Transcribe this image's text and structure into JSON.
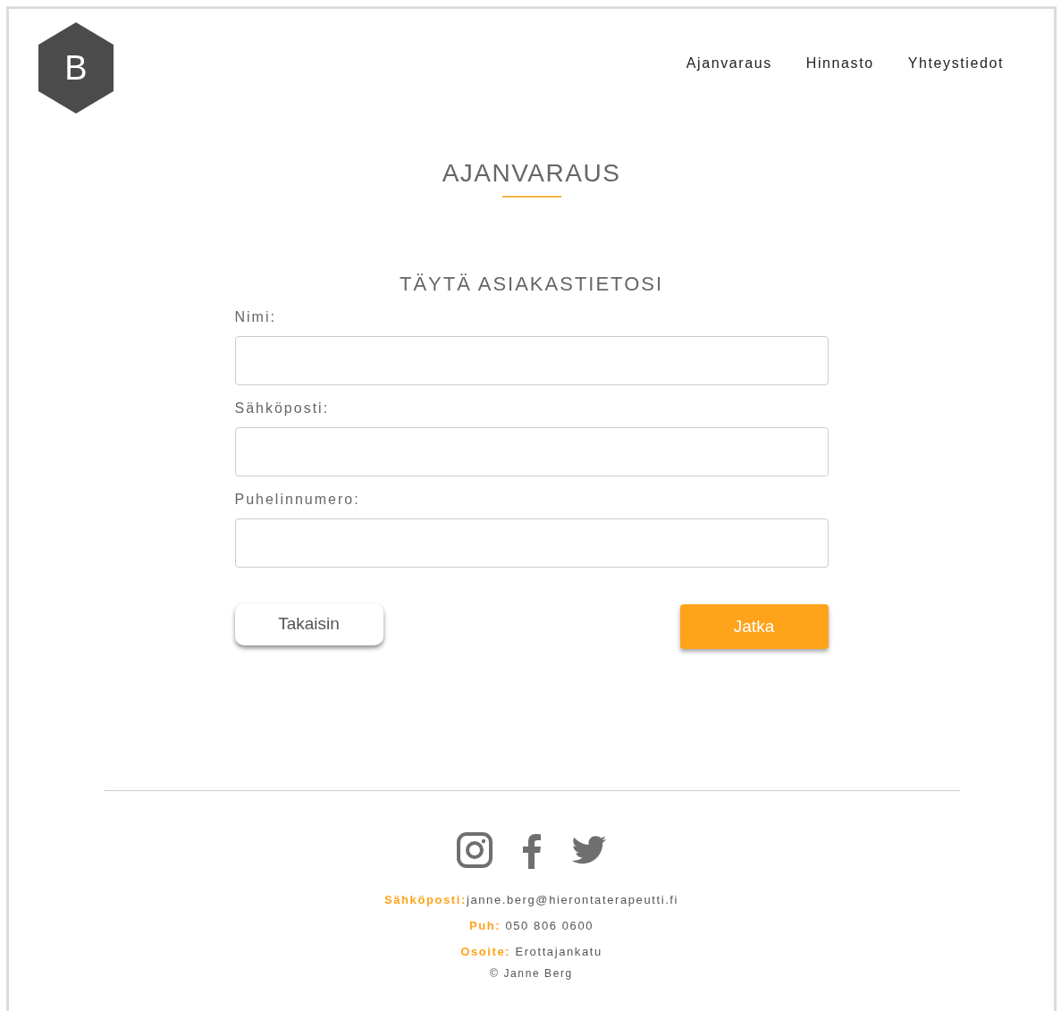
{
  "logo": {
    "letter": "B"
  },
  "nav": [
    {
      "label": "Ajanvaraus"
    },
    {
      "label": "Hinnasto"
    },
    {
      "label": "Yhteystiedot"
    }
  ],
  "page_title": "AJANVARAUS",
  "form": {
    "heading": "TÄYTÄ ASIAKASTIETOSI",
    "fields": [
      {
        "label": "Nimi:"
      },
      {
        "label": "Sähköposti:"
      },
      {
        "label": "Puhelinnumero:"
      }
    ],
    "buttons": [
      {
        "label": "Takaisin",
        "kind": "secondary"
      },
      {
        "label": "Jatka",
        "kind": "primary"
      }
    ]
  },
  "footer": {
    "social": [
      {
        "kind": "instagram"
      },
      {
        "kind": "facebook"
      },
      {
        "kind": "twitter"
      }
    ],
    "contacts": [
      {
        "label": "Sähköposti:",
        "value": "janne.berg@hierontaterapeutti.fi"
      },
      {
        "label": "Puh:",
        "value": " 050 806 0600"
      },
      {
        "label": "Osoite:",
        "value": " Erottajankatu"
      }
    ],
    "copyright": "© Janne Berg"
  }
}
